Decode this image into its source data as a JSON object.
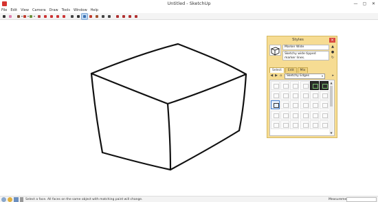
{
  "window": {
    "title": "Untitled - SketchUp",
    "min": "—",
    "max": "▢",
    "close": "✕"
  },
  "menu": [
    "File",
    "Edit",
    "View",
    "Camera",
    "Draw",
    "Tools",
    "Window",
    "Help"
  ],
  "toolbar": {
    "tools": [
      {
        "name": "select-tool",
        "color": "#333333"
      },
      {
        "name": "eraser-tool",
        "color": "#e07fb0"
      },
      {
        "name": "line-tool",
        "color": "#7a4a2a",
        "dropdown": true
      },
      {
        "name": "arc-tool",
        "color": "#c0392b",
        "dropdown": true
      },
      {
        "name": "shape-tool",
        "color": "#6a8f3a",
        "dropdown": true
      },
      {
        "name": "pushpull-tool",
        "color": "#b83b3b"
      },
      {
        "name": "offset-tool",
        "color": "#cc3333"
      },
      {
        "name": "move-tool",
        "color": "#cc3333"
      },
      {
        "name": "rotate-tool",
        "color": "#cc3333"
      },
      {
        "name": "scale-tool",
        "color": "#cc3333"
      },
      {
        "name": "tape-tool",
        "color": "#444444"
      },
      {
        "name": "text-tool",
        "color": "#333333"
      },
      {
        "name": "paint-tool",
        "color": "#3a6fb0",
        "active": true
      },
      {
        "name": "orbit-tool",
        "color": "#c0392b"
      },
      {
        "name": "pan-tool",
        "color": "#a0522d"
      },
      {
        "name": "zoom-tool",
        "color": "#444444"
      },
      {
        "name": "zoom-extents-tool",
        "color": "#444444"
      },
      {
        "name": "warehouse-tool",
        "color": "#b03030"
      },
      {
        "name": "extension-warehouse-tool",
        "color": "#b03030"
      },
      {
        "name": "layout-tool",
        "color": "#b03030"
      },
      {
        "name": "extension-manager-tool",
        "color": "#b03030"
      }
    ]
  },
  "styles_panel": {
    "title": "Styles",
    "style_name": "Marker Wide",
    "style_description": "Sketchy wide tipped marker lines.",
    "tabs": [
      "Select",
      "Edit",
      "Mix"
    ],
    "active_tab": "Select",
    "collection": "Sketchy Edges",
    "thumbnails": [
      "light",
      "light",
      "light",
      "light",
      "dark",
      "dark",
      "light",
      "light",
      "light",
      "light",
      "light",
      "light",
      "sel",
      "light",
      "light",
      "light",
      "light",
      "light",
      "light",
      "light",
      "light",
      "light",
      "light",
      "light",
      "light",
      "light",
      "light",
      "light",
      "light",
      "light"
    ]
  },
  "status": {
    "text": "Select a face. All faces on the same object with matching paint will change.",
    "measurements_label": "Measurements",
    "measurements_value": ""
  }
}
